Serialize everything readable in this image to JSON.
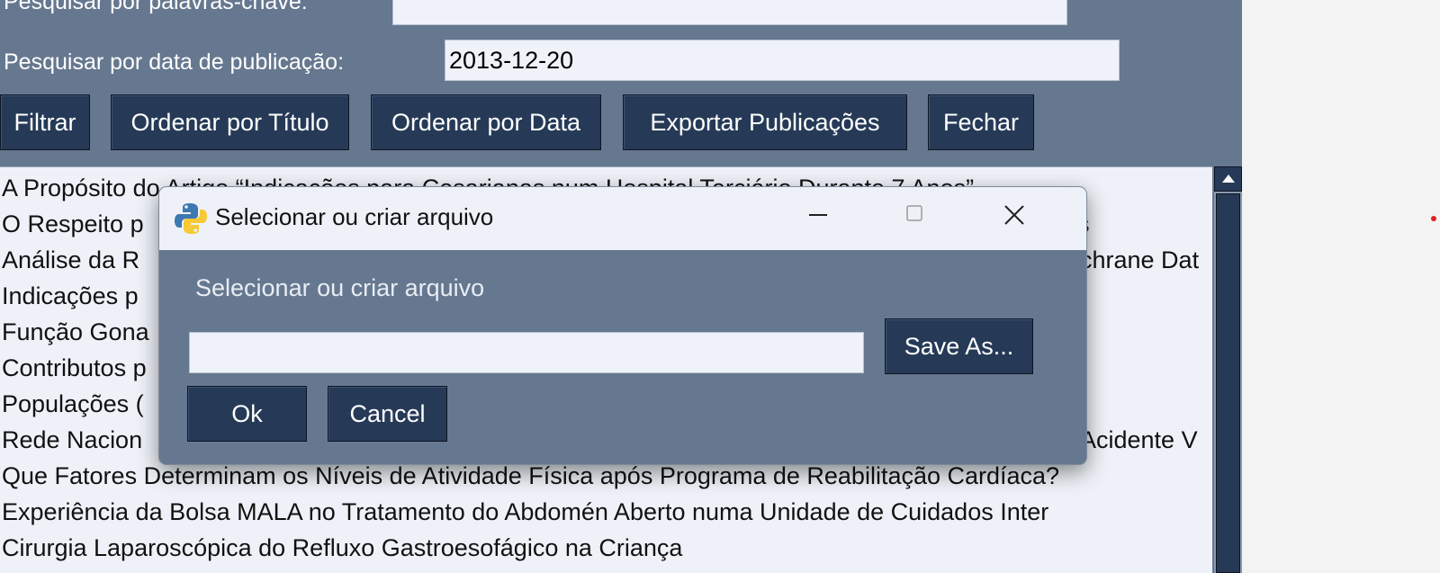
{
  "search": {
    "keywords_label": "Pesquisar por palavras-chave:",
    "keywords_value": "",
    "date_label": "Pesquisar por data de publicação:",
    "date_value": "2013-12-20"
  },
  "toolbar": {
    "filter_label": "Filtrar",
    "sort_title_label": "Ordenar por Título",
    "sort_date_label": "Ordenar por Data",
    "export_label": "Exportar Publicações",
    "close_label": "Fechar"
  },
  "publications": [
    "A Propósito do Artigo “Indicações para Cesarianas num Hospital Terciário Durante 7 Anos”",
    "O Respeito p",
    "Análise da R",
    "Indicações p",
    "Função Gona",
    "Contributos p",
    "Populações (",
    "Rede Nacion",
    "Que Fatores Determinam os Níveis de Atividade Física após Programa de Reabilitação Cardíaca?",
    "Experiência da Bolsa MALA no Tratamento do Abdomén Aberto numa Unidade de Cuidados Inter",
    "Cirurgia Laparoscópica do Refluxo Gastroesofágico na Criança"
  ],
  "partial_right_texts": {
    "row2": "s",
    "row3": "chrane Dat",
    "row8": "Acidente V"
  },
  "dialog": {
    "title": "Selecionar ou criar arquivo",
    "prompt": "Selecionar ou criar arquivo",
    "file_value": "",
    "save_as_label": "Save As...",
    "ok_label": "Ok",
    "cancel_label": "Cancel",
    "icon": "python-icon"
  },
  "colors": {
    "app_background": "#66788f",
    "button": "#263a57",
    "input": "#eff3f9",
    "titlebar": "#eef2f8"
  }
}
